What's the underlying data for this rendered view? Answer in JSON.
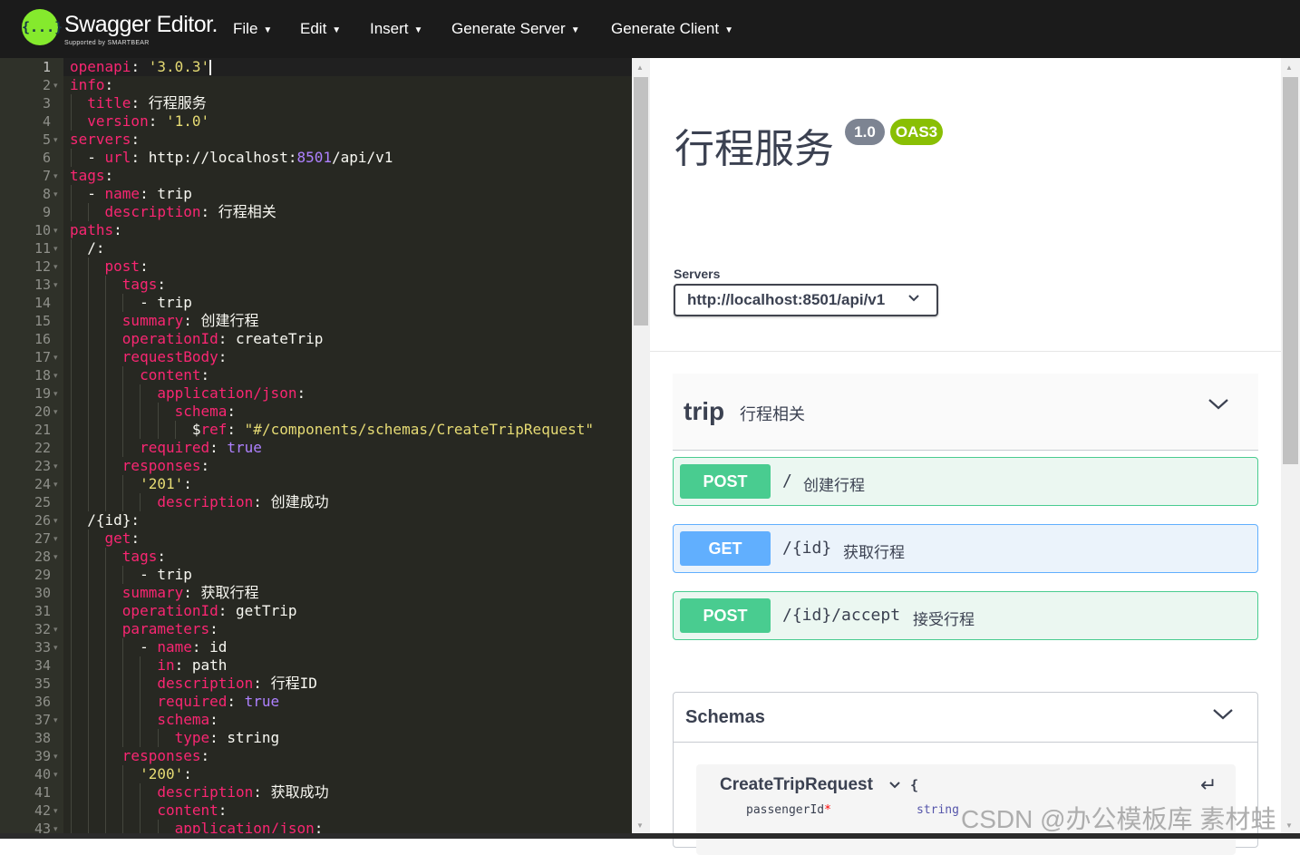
{
  "header": {
    "brand": "Swagger Editor.",
    "brand_sub": "Supported by SMARTBEAR",
    "logo_glyph": "{...}",
    "menu": [
      "File",
      "Edit",
      "Insert",
      "Generate Server",
      "Generate Client"
    ],
    "colors": {
      "bar": "#1b1b1b",
      "logo": "#85ea2d"
    }
  },
  "editor": {
    "lines": [
      {
        "n": "1",
        "fold": false,
        "indent": "",
        "segs": [
          [
            "k",
            "openapi"
          ],
          [
            "t",
            ": "
          ],
          [
            "s",
            "'3.0.3'"
          ]
        ]
      },
      {
        "n": "2",
        "fold": true,
        "indent": "",
        "segs": [
          [
            "k",
            "info"
          ],
          [
            "t",
            ":"
          ]
        ]
      },
      {
        "n": "3",
        "fold": false,
        "indent": "  ",
        "segs": [
          [
            "k",
            "title"
          ],
          [
            "t",
            ": 行程服务"
          ]
        ]
      },
      {
        "n": "4",
        "fold": false,
        "indent": "  ",
        "segs": [
          [
            "k",
            "version"
          ],
          [
            "t",
            ": "
          ],
          [
            "s",
            "'1.0'"
          ]
        ]
      },
      {
        "n": "5",
        "fold": true,
        "indent": "",
        "segs": [
          [
            "k",
            "servers"
          ],
          [
            "t",
            ":"
          ]
        ]
      },
      {
        "n": "6",
        "fold": false,
        "indent": "  ",
        "segs": [
          [
            "t",
            "- "
          ],
          [
            "k",
            "url"
          ],
          [
            "t",
            ": http://localhost:"
          ],
          [
            "n",
            "8501"
          ],
          [
            "t",
            "/api/v1"
          ]
        ]
      },
      {
        "n": "7",
        "fold": true,
        "indent": "",
        "segs": [
          [
            "k",
            "tags"
          ],
          [
            "t",
            ":"
          ]
        ]
      },
      {
        "n": "8",
        "fold": true,
        "indent": "  ",
        "segs": [
          [
            "t",
            "- "
          ],
          [
            "k",
            "name"
          ],
          [
            "t",
            ": trip"
          ]
        ]
      },
      {
        "n": "9",
        "fold": false,
        "indent": "    ",
        "segs": [
          [
            "k",
            "description"
          ],
          [
            "t",
            ": 行程相关"
          ]
        ]
      },
      {
        "n": "10",
        "fold": true,
        "indent": "",
        "segs": [
          [
            "k",
            "paths"
          ],
          [
            "t",
            ":"
          ]
        ]
      },
      {
        "n": "11",
        "fold": true,
        "indent": "  ",
        "segs": [
          [
            "t",
            "/:"
          ]
        ]
      },
      {
        "n": "12",
        "fold": true,
        "indent": "    ",
        "segs": [
          [
            "k",
            "post"
          ],
          [
            "t",
            ":"
          ]
        ]
      },
      {
        "n": "13",
        "fold": true,
        "indent": "      ",
        "segs": [
          [
            "k",
            "tags"
          ],
          [
            "t",
            ":"
          ]
        ]
      },
      {
        "n": "14",
        "fold": false,
        "indent": "        ",
        "segs": [
          [
            "t",
            "- trip"
          ]
        ]
      },
      {
        "n": "15",
        "fold": false,
        "indent": "      ",
        "segs": [
          [
            "k",
            "summary"
          ],
          [
            "t",
            ": 创建行程"
          ]
        ]
      },
      {
        "n": "16",
        "fold": false,
        "indent": "      ",
        "segs": [
          [
            "k",
            "operationId"
          ],
          [
            "t",
            ": createTrip"
          ]
        ]
      },
      {
        "n": "17",
        "fold": true,
        "indent": "      ",
        "segs": [
          [
            "k",
            "requestBody"
          ],
          [
            "t",
            ":"
          ]
        ]
      },
      {
        "n": "18",
        "fold": true,
        "indent": "        ",
        "segs": [
          [
            "k",
            "content"
          ],
          [
            "t",
            ":"
          ]
        ]
      },
      {
        "n": "19",
        "fold": true,
        "indent": "          ",
        "segs": [
          [
            "k",
            "application/json"
          ],
          [
            "t",
            ":"
          ]
        ]
      },
      {
        "n": "20",
        "fold": true,
        "indent": "            ",
        "segs": [
          [
            "k",
            "schema"
          ],
          [
            "t",
            ":"
          ]
        ]
      },
      {
        "n": "21",
        "fold": false,
        "indent": "              ",
        "segs": [
          [
            "t",
            "$"
          ],
          [
            "k",
            "ref"
          ],
          [
            "t",
            ": "
          ],
          [
            "s",
            "\"#/components/schemas/CreateTripRequest\""
          ]
        ]
      },
      {
        "n": "22",
        "fold": false,
        "indent": "        ",
        "segs": [
          [
            "k",
            "required"
          ],
          [
            "t",
            ": "
          ],
          [
            "n",
            "true"
          ]
        ]
      },
      {
        "n": "23",
        "fold": true,
        "indent": "      ",
        "segs": [
          [
            "k",
            "responses"
          ],
          [
            "t",
            ":"
          ]
        ]
      },
      {
        "n": "24",
        "fold": true,
        "indent": "        ",
        "segs": [
          [
            "s",
            "'201'"
          ],
          [
            "t",
            ":"
          ]
        ]
      },
      {
        "n": "25",
        "fold": false,
        "indent": "          ",
        "segs": [
          [
            "k",
            "description"
          ],
          [
            "t",
            ": 创建成功"
          ]
        ]
      },
      {
        "n": "26",
        "fold": true,
        "indent": "  ",
        "segs": [
          [
            "t",
            "/{id}:"
          ]
        ]
      },
      {
        "n": "27",
        "fold": true,
        "indent": "    ",
        "segs": [
          [
            "k",
            "get"
          ],
          [
            "t",
            ":"
          ]
        ]
      },
      {
        "n": "28",
        "fold": true,
        "indent": "      ",
        "segs": [
          [
            "k",
            "tags"
          ],
          [
            "t",
            ":"
          ]
        ]
      },
      {
        "n": "29",
        "fold": false,
        "indent": "        ",
        "segs": [
          [
            "t",
            "- trip"
          ]
        ]
      },
      {
        "n": "30",
        "fold": false,
        "indent": "      ",
        "segs": [
          [
            "k",
            "summary"
          ],
          [
            "t",
            ": 获取行程"
          ]
        ]
      },
      {
        "n": "31",
        "fold": false,
        "indent": "      ",
        "segs": [
          [
            "k",
            "operationId"
          ],
          [
            "t",
            ": getTrip"
          ]
        ]
      },
      {
        "n": "32",
        "fold": true,
        "indent": "      ",
        "segs": [
          [
            "k",
            "parameters"
          ],
          [
            "t",
            ":"
          ]
        ]
      },
      {
        "n": "33",
        "fold": true,
        "indent": "        ",
        "segs": [
          [
            "t",
            "- "
          ],
          [
            "k",
            "name"
          ],
          [
            "t",
            ": id"
          ]
        ]
      },
      {
        "n": "34",
        "fold": false,
        "indent": "          ",
        "segs": [
          [
            "k",
            "in"
          ],
          [
            "t",
            ": path"
          ]
        ]
      },
      {
        "n": "35",
        "fold": false,
        "indent": "          ",
        "segs": [
          [
            "k",
            "description"
          ],
          [
            "t",
            ": 行程ID"
          ]
        ]
      },
      {
        "n": "36",
        "fold": false,
        "indent": "          ",
        "segs": [
          [
            "k",
            "required"
          ],
          [
            "t",
            ": "
          ],
          [
            "n",
            "true"
          ]
        ]
      },
      {
        "n": "37",
        "fold": true,
        "indent": "          ",
        "segs": [
          [
            "k",
            "schema"
          ],
          [
            "t",
            ":"
          ]
        ]
      },
      {
        "n": "38",
        "fold": false,
        "indent": "            ",
        "segs": [
          [
            "k",
            "type"
          ],
          [
            "t",
            ": string"
          ]
        ]
      },
      {
        "n": "39",
        "fold": true,
        "indent": "      ",
        "segs": [
          [
            "k",
            "responses"
          ],
          [
            "t",
            ":"
          ]
        ]
      },
      {
        "n": "40",
        "fold": true,
        "indent": "        ",
        "segs": [
          [
            "s",
            "'200'"
          ],
          [
            "t",
            ":"
          ]
        ]
      },
      {
        "n": "41",
        "fold": false,
        "indent": "          ",
        "segs": [
          [
            "k",
            "description"
          ],
          [
            "t",
            ": 获取成功"
          ]
        ]
      },
      {
        "n": "42",
        "fold": true,
        "indent": "          ",
        "segs": [
          [
            "k",
            "content"
          ],
          [
            "t",
            ":"
          ]
        ]
      },
      {
        "n": "43",
        "fold": true,
        "indent": "            ",
        "segs": [
          [
            "k",
            "application/json"
          ],
          [
            "t",
            ":"
          ]
        ]
      }
    ],
    "colors": {
      "bg": "#272822",
      "key": "#f92672",
      "string": "#e6db74",
      "number": "#ae81ff",
      "text": "#f8f8f2"
    }
  },
  "preview": {
    "title": "行程服务",
    "version_badge": "1.0",
    "oas_badge": "OAS3",
    "servers_label": "Servers",
    "server_selected": "http://localhost:8501/api/v1",
    "tag": {
      "name": "trip",
      "description": "行程相关"
    },
    "operations": [
      {
        "method": "POST",
        "path": "/",
        "summary": "创建行程"
      },
      {
        "method": "GET",
        "path": "/{id}",
        "summary": "获取行程"
      },
      {
        "method": "POST",
        "path": "/{id}/accept",
        "summary": "接受行程"
      }
    ],
    "schemas": {
      "title": "Schemas",
      "model_name": "CreateTripRequest",
      "model_brace": "{",
      "property_name": "passengerId",
      "property_required_mark": "*",
      "property_type": "string"
    },
    "colors": {
      "post": "#49cc90",
      "get": "#61affe",
      "version_badge": "#7d8492",
      "oas_badge": "#89bf04"
    }
  },
  "watermark": "CSDN @办公模板库 素材蛙"
}
